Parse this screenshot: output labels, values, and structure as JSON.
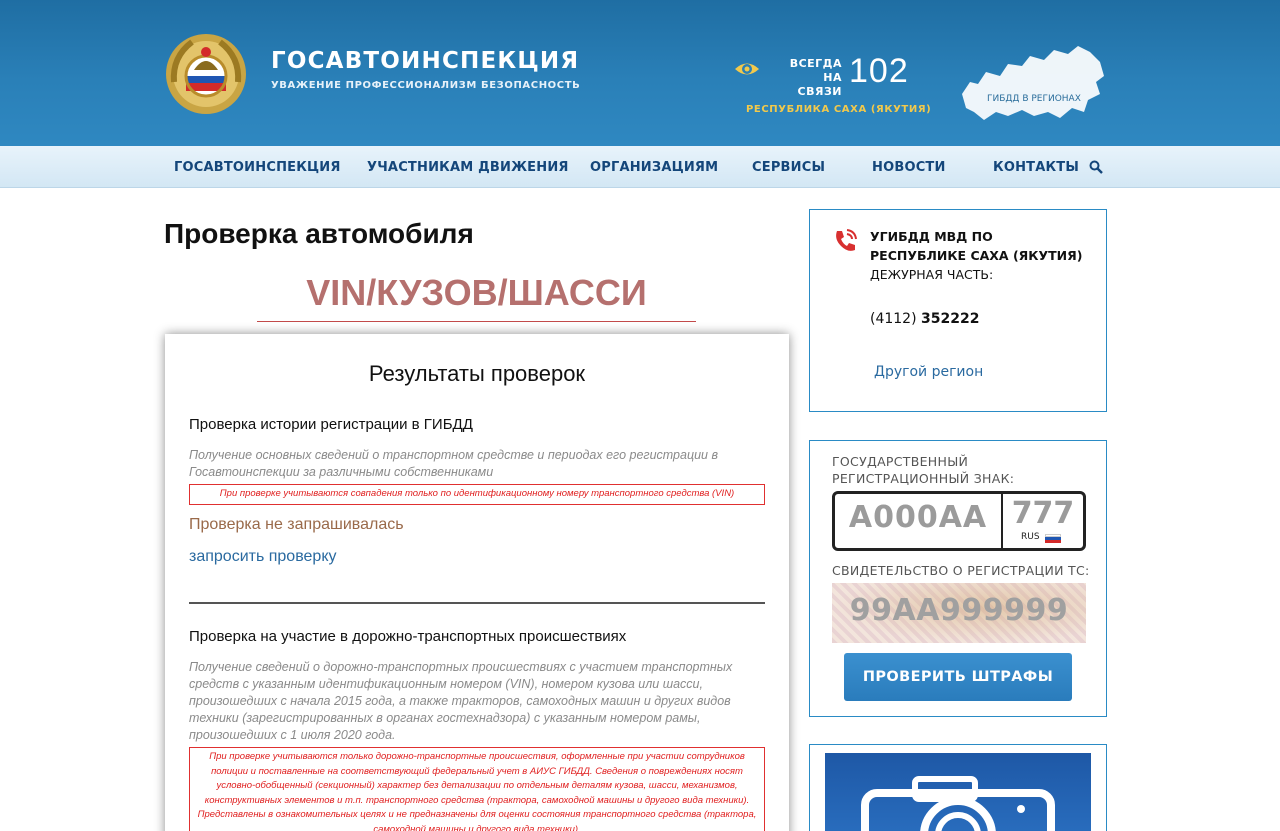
{
  "header": {
    "brand_title": "ГОСАВТОИНСПЕКЦИЯ",
    "brand_subtitle": "УВАЖЕНИЕ ПРОФЕССИОНАЛИЗМ БЕЗОПАСНОСТЬ",
    "always_line1": "ВСЕГДА",
    "always_line2": "НА СВЯЗИ",
    "phone": "102",
    "region": "РЕСПУБЛИКА САХА (ЯКУТИЯ)",
    "map_label": "ГИБДД В РЕГИОНАХ"
  },
  "nav": {
    "items": [
      {
        "label": "ГОСАВТОИНСПЕКЦИЯ"
      },
      {
        "label": "УЧАСТНИКАМ ДВИЖЕНИЯ"
      },
      {
        "label": "ОРГАНИЗАЦИЯМ"
      },
      {
        "label": "СЕРВИСЫ"
      },
      {
        "label": "НОВОСТИ"
      },
      {
        "label": "КОНТАКТЫ"
      }
    ],
    "search_icon": "search-icon"
  },
  "main": {
    "page_title": "Проверка автомобиля",
    "vin_heading": "VIN/КУЗОВ/ШАССИ",
    "results": {
      "title": "Результаты проверок",
      "section1": {
        "title": "Проверка истории регистрации в ГИБДД",
        "description": "Получение основных сведений о транспортном средстве и периодах его регистрации в Госавтоинспекции за различными собственниками",
        "warning": "При проверке учитываются совпадения только по идентификационному номеру транспортного средства (VIN)",
        "status": "Проверка не запрашивалась",
        "request_link": "запросить проверку"
      },
      "section2": {
        "title": "Проверка на участие в дорожно-транспортных происшествиях",
        "description": "Получение сведений о дорожно-транспортных происшествиях с участием транспортных средств с указанным идентификационным номером (VIN), номером кузова или шасси, произошедших с начала 2015 года, а также тракторов, самоходных машин и других видов техники (зарегистрированных в органах гостехнадзора) с указанным номером рамы, произошедших с 1 июля 2020 года.",
        "warning": "При проверке учитываются только дорожно-транспортные происшествия, оформленные при участии сотрудников полиции и поставленные на соответствующий федеральный учет в АИУС ГИБДД. Сведения о повреждениях носят условно-обобщенный (секционный) характер без детализации по отдельным деталям кузова, шасси, механизмов, конструктивных элементов и т.п. транспортного средства (трактора, самоходной машины и другого вида техники). Представлены в ознакомительных целях и не предназначены для оценки состояния транспортного средства (трактора, самоходной машины и другого вида техники)."
      }
    }
  },
  "sidebar": {
    "contact": {
      "org_name": "УГИБДД МВД ПО РЕСПУБЛИКЕ САХА (ЯКУТИЯ)",
      "duty_label": "ДЕЖУРНАЯ ЧАСТЬ:",
      "phone_code": "(4112)",
      "phone_number": "352222",
      "other_region": "Другой регион"
    },
    "plate": {
      "plate_label_1": "ГОСУДАРСТВЕННЫЙ",
      "plate_label_2": "РЕГИСТРАЦИОННЫЙ ЗНАК:",
      "plate_number": "А000АА",
      "plate_region": "777",
      "plate_country": "RUS",
      "cert_label": "СВИДЕТЕЛЬСТВО О РЕГИСТРАЦИИ ТС:",
      "cert_number": "99АА999999",
      "fines_button": "ПРОВЕРИТЬ ШТРАФЫ"
    }
  },
  "colors": {
    "header_blue": "#2a80b8",
    "nav_text": "#14467a",
    "vin_heading": "#b5706e",
    "warning_red": "#e02020",
    "link_blue": "#2a6aa0",
    "region_yellow": "#f2c94c",
    "button_blue": "#3b90cf"
  }
}
